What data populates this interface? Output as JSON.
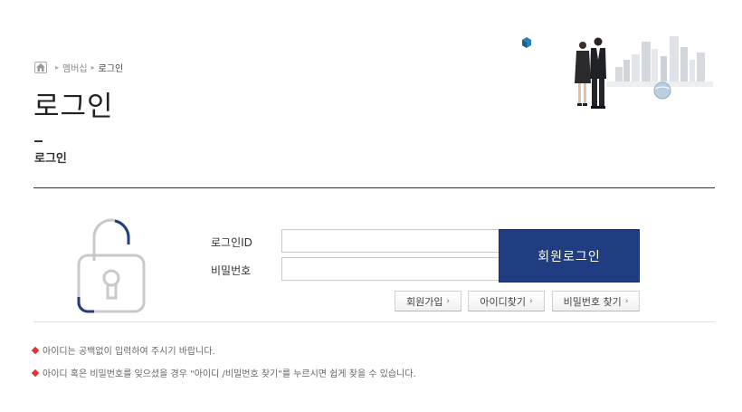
{
  "breadcrumb": {
    "icon": "home-icon",
    "items": [
      "멤버십",
      "로그인"
    ]
  },
  "page": {
    "title": "로그인",
    "subtitle": "로그인"
  },
  "form": {
    "id_label": "로그인ID",
    "pw_label": "비밀번호",
    "id_value": "",
    "pw_value": "",
    "login_button": "회원로그인"
  },
  "links": {
    "signup": "회원가입",
    "find_id": "아이디찾기",
    "find_pw": "비밀번호 찾기"
  },
  "notes": [
    "아이디는 공백없이 입력하여 주시기 바랍니다.",
    "아이디 혹은 비밀번호를 잊으셨을 경우 \"아이디 /비밀번호 찾기\"를 누르시면 쉽게 찾을 수 있습니다."
  ],
  "icons": {
    "lock": "lock-icon",
    "chevron": "chevron-right-icon",
    "bullet": "diamond-bullet-icon"
  },
  "colors": {
    "primary": "#1f3d80",
    "bullet": "#dd3333",
    "lock_accent": "#1f3d80",
    "lock_outline": "#c9c9c9"
  }
}
